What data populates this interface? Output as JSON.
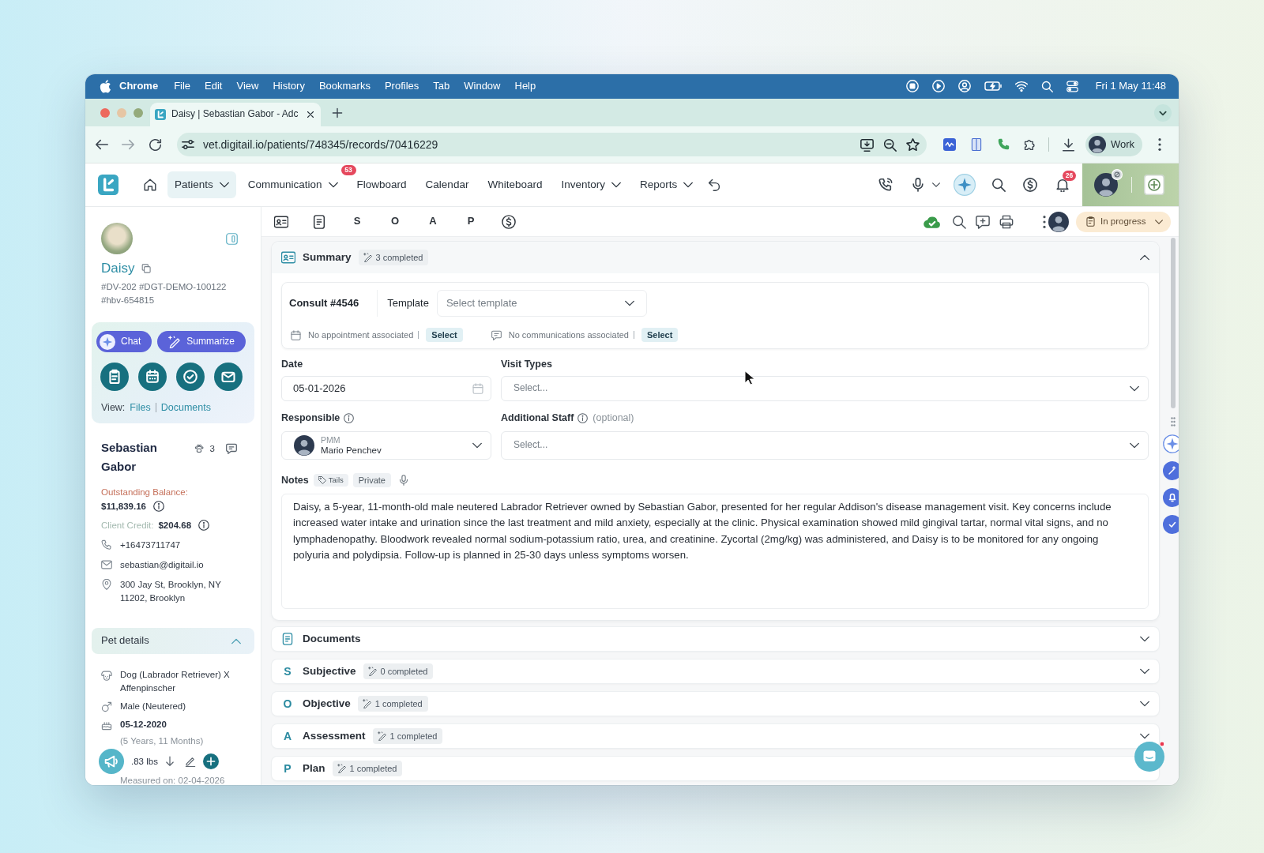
{
  "menu_bar": {
    "app": "Chrome",
    "items": [
      "File",
      "Edit",
      "View",
      "History",
      "Bookmarks",
      "Profiles",
      "Tab",
      "Window",
      "Help"
    ],
    "clock": "Fri 1 May 11:48"
  },
  "browser": {
    "tabs": [
      {
        "title": "Daisy | Sebastian Gabor - Adc",
        "selected": true
      }
    ],
    "url": "vet.digitail.io/patients/748345/records/70416229",
    "profile": "Work"
  },
  "nav": {
    "items": [
      {
        "label": "Patients",
        "selected": true,
        "dropdown": true
      },
      {
        "label": "Communication",
        "selected": false,
        "dropdown": true,
        "badge": "53"
      },
      {
        "label": "Flowboard",
        "selected": false,
        "dropdown": false
      },
      {
        "label": "Calendar",
        "selected": false,
        "dropdown": false
      },
      {
        "label": "Whiteboard",
        "selected": false,
        "dropdown": false
      },
      {
        "label": "Inventory",
        "selected": false,
        "dropdown": true
      },
      {
        "label": "Reports",
        "selected": false,
        "dropdown": true
      }
    ],
    "notifications": "26"
  },
  "pet": {
    "name": "Daisy",
    "ids": "#DV-202 #DGT-DEMO-100122 #hbv-654815"
  },
  "actions": {
    "buttons": [
      {
        "kind": "chat",
        "label": "Chat"
      },
      {
        "kind": "summarize",
        "label": "Summarize"
      }
    ],
    "view_label": "View:",
    "links": [
      "Files",
      "Documents"
    ]
  },
  "owner": {
    "name": "Sebastian Gabor",
    "pets": "3",
    "balance_label": "Outstanding Balance:",
    "balance": "$11,839.16",
    "credit_label": "Client Credit:",
    "credit": "$204.68",
    "contacts": [
      {
        "kind": "phone",
        "text": "+16473711747"
      },
      {
        "kind": "email",
        "text": "sebastian@digitail.io"
      },
      {
        "kind": "address",
        "text": "300 Jay St, Brooklyn, NY 11202, Brooklyn"
      }
    ]
  },
  "pet_details": {
    "title": "Pet details",
    "expanded": true,
    "rows": [
      {
        "kind": "breed",
        "text": "Dog (Labrador Retriever) X Affenpinscher"
      },
      {
        "kind": "sex",
        "text": "Male (Neutered)"
      },
      {
        "kind": "birth",
        "text": "05-12-2020",
        "note": "(5 Years, 11 Months)"
      },
      {
        "kind": "weight",
        "text": ".83 lbs"
      },
      {
        "kind": "measured",
        "text": "Measured on: 02-04-2026"
      }
    ]
  },
  "record_toolbar": {
    "tabs": [
      {
        "label": "S",
        "selected": false
      },
      {
        "label": "O",
        "selected": false
      },
      {
        "label": "A",
        "selected": false
      },
      {
        "label": "P",
        "selected": false
      }
    ],
    "status": "In progress"
  },
  "summary": {
    "title": "Summary",
    "completed": "3 completed",
    "expanded": true,
    "consult": "Consult #4546",
    "template": {
      "label": "Template",
      "placeholder": "Select template"
    },
    "links": [
      {
        "kind": "appointment",
        "text": "No appointment associated",
        "action": "Select"
      },
      {
        "kind": "communication",
        "text": "No communications associated",
        "action": "Select"
      }
    ],
    "date": {
      "label": "Date",
      "value": "05-01-2026"
    },
    "visit_types": {
      "label": "Visit Types",
      "placeholder": "Select..."
    },
    "responsible": {
      "label": "Responsible",
      "role": "PMM",
      "name": "Mario Penchev"
    },
    "additional_staff": {
      "label": "Additional Staff",
      "hint": "(optional)",
      "placeholder": "Select..."
    },
    "notes": {
      "label": "Notes",
      "tags": [
        {
          "kind": "tails",
          "label": "Tails"
        },
        {
          "kind": "private",
          "label": "Private"
        }
      ],
      "text": "Daisy, a 5-year, 11-month-old male neutered Labrador Retriever owned by Sebastian Gabor, presented for her regular Addison's disease management visit. Key concerns include increased water intake and urination since the last treatment and mild anxiety, especially at the clinic. Physical examination showed mild gingival tartar, normal vital signs, and no lymphadenopathy. Bloodwork revealed normal sodium-potassium ratio, urea, and creatinine. Zycortal (2mg/kg) was administered, and Daisy is to be monitored for any ongoing polyuria and polydipsia. Follow-up is planned in 25-30 days unless symptoms worsen."
    }
  },
  "sections": [
    {
      "kind": "documents",
      "title": "Documents",
      "expanded": false
    },
    {
      "kind": "letter",
      "letter": "S",
      "title": "Subjective",
      "completed": "0 completed",
      "expanded": false
    },
    {
      "kind": "letter",
      "letter": "O",
      "title": "Objective",
      "completed": "1 completed",
      "expanded": false
    },
    {
      "kind": "letter",
      "letter": "A",
      "title": "Assessment",
      "completed": "1 completed",
      "expanded": false
    },
    {
      "kind": "letter",
      "letter": "P",
      "title": "Plan",
      "completed": "1 completed"
    }
  ]
}
